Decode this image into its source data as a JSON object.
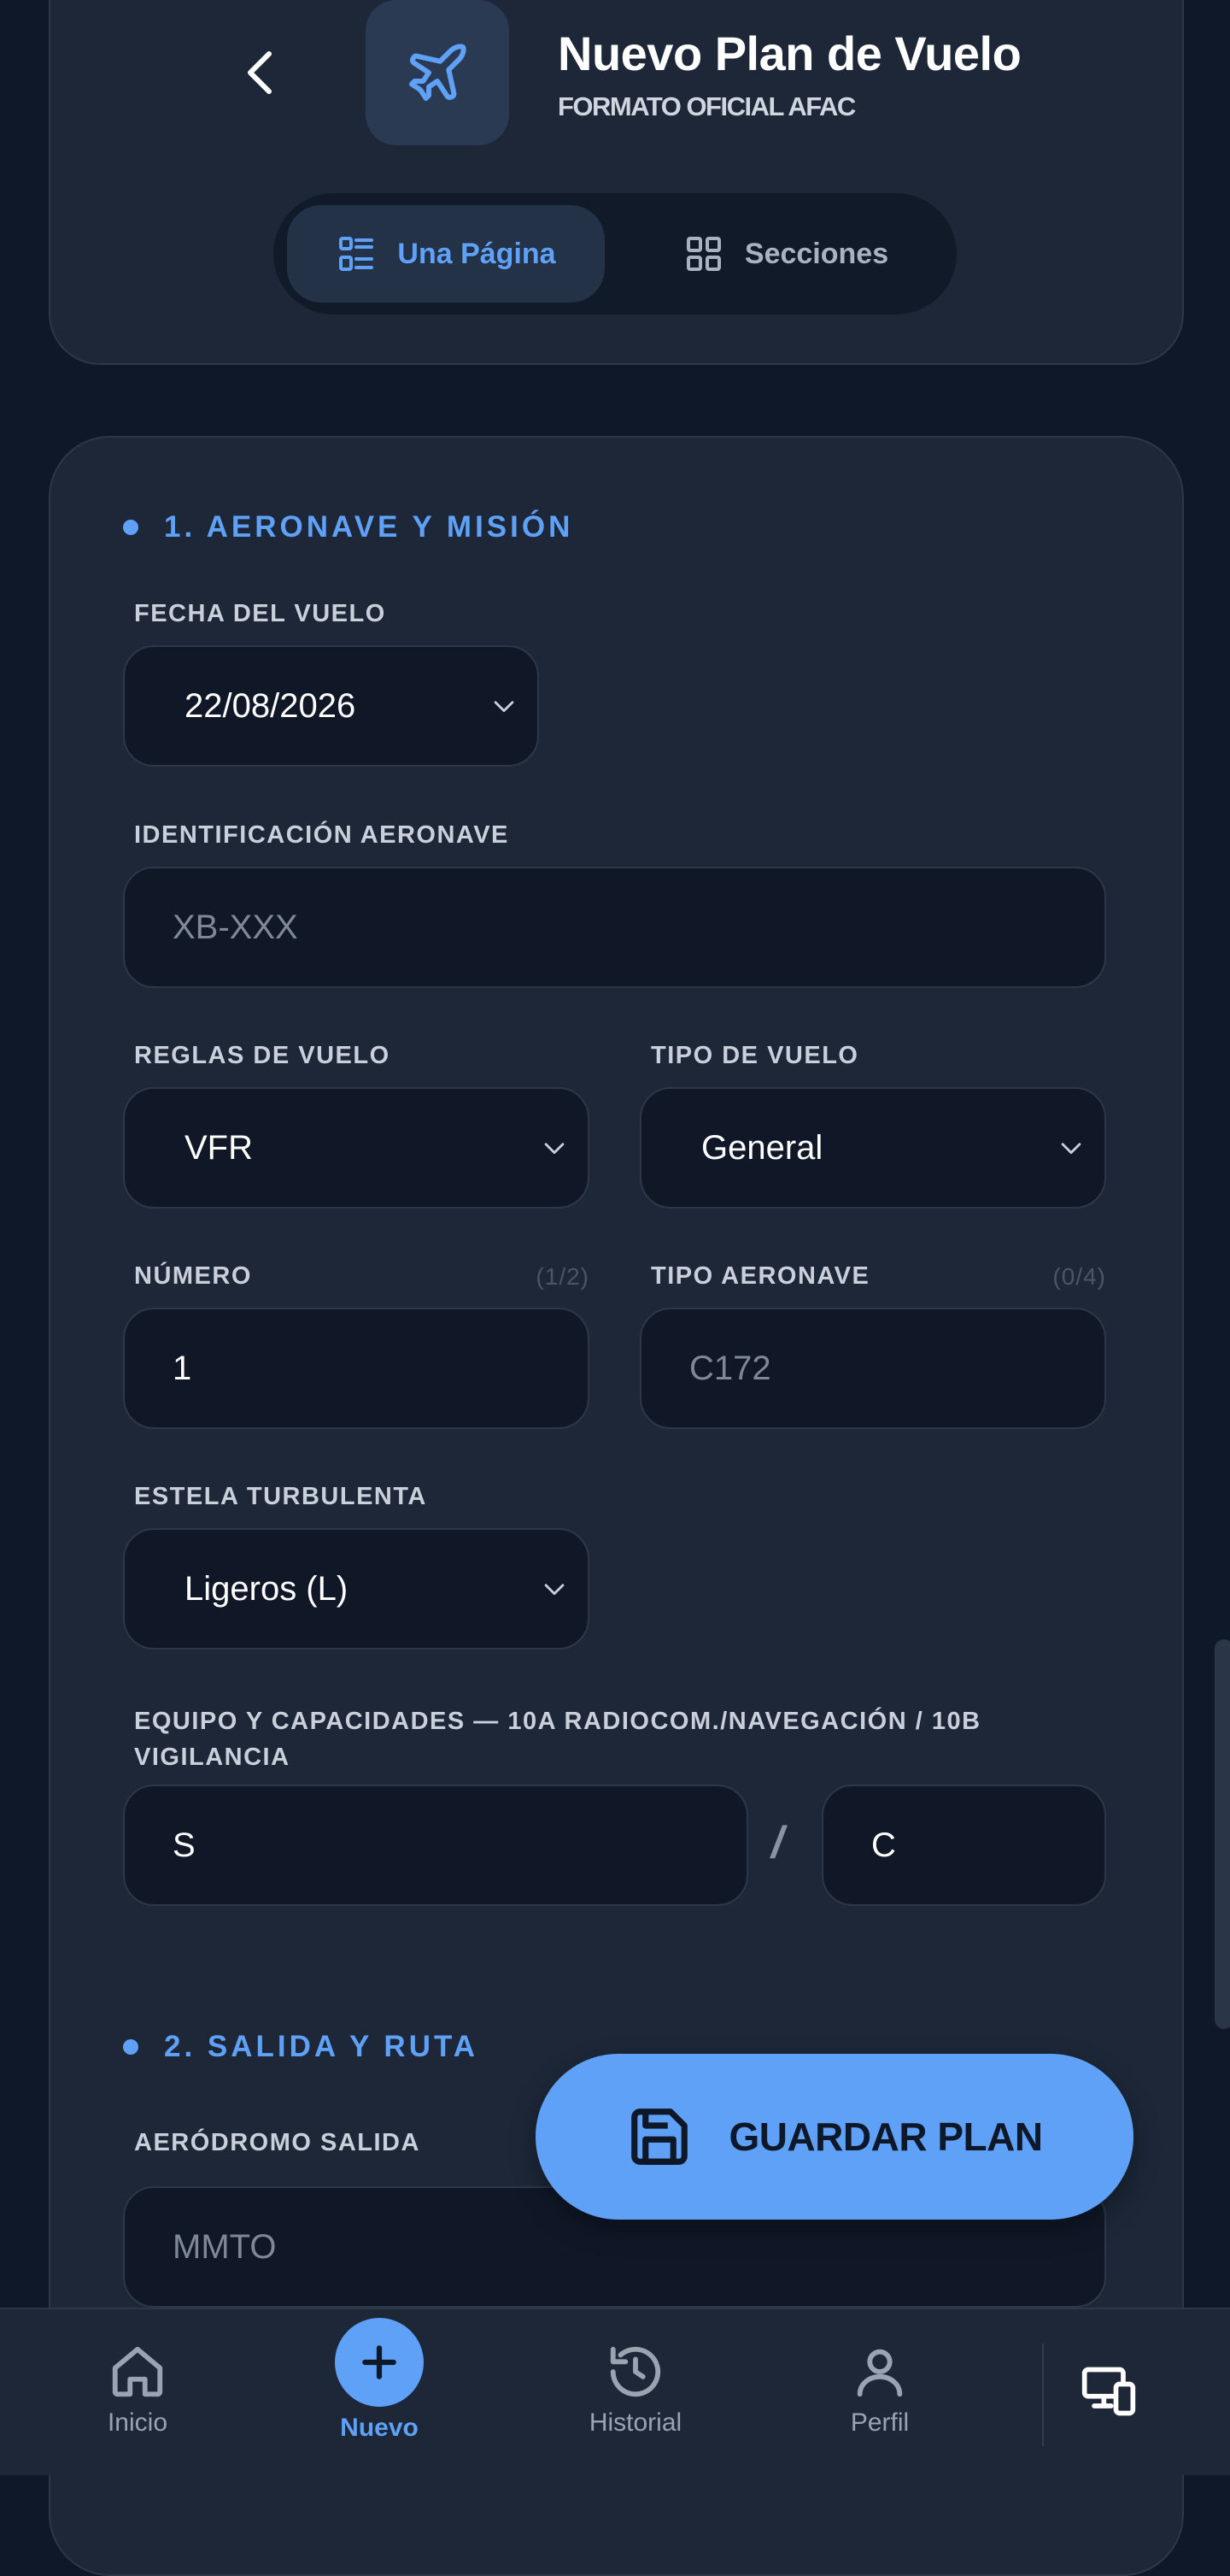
{
  "header": {
    "title": "Nuevo Plan de Vuelo",
    "subtitle": "FORMATO OFICIAL AFAC",
    "back_icon": "chevron-left-icon",
    "app_icon": "airplane-icon"
  },
  "view_toggle": {
    "single_label": "Una Página",
    "sections_label": "Secciones",
    "selected": "Una Página"
  },
  "section1": {
    "title": "1. AERONAVE Y MISIÓN",
    "flight_date": {
      "label": "FECHA DEL VUELO",
      "value": "22/08/2026"
    },
    "aircraft_id": {
      "label": "IDENTIFICACIÓN AERONAVE",
      "placeholder": "XB-XXX",
      "value": ""
    },
    "flight_rules": {
      "label": "REGLAS DE VUELO",
      "value": "VFR"
    },
    "flight_type": {
      "label": "TIPO DE VUELO",
      "value": "General"
    },
    "number": {
      "label": "NÚMERO",
      "counter": "(1/2)",
      "value": "1"
    },
    "aircraft_type": {
      "label": "TIPO AERONAVE",
      "counter": "(0/4)",
      "placeholder": "C172",
      "value": ""
    },
    "wake_turbulence": {
      "label": "ESTELA TURBULENTA",
      "value": "Ligeros (L)"
    },
    "equipment": {
      "label": "EQUIPO Y CAPACIDADES — 10A RADIOCOM./NAVEGACIÓN  /  10B VIGILANCIA",
      "value_10a": "S",
      "separator": "/",
      "value_10b": "C"
    }
  },
  "section2": {
    "title": "2. SALIDA Y RUTA",
    "departure": {
      "label": "AERÓDROMO SALIDA",
      "placeholder": "MMTO",
      "value": ""
    }
  },
  "save_button": {
    "label": "GUARDAR PLAN",
    "icon": "save-icon"
  },
  "bottom_nav": {
    "items": [
      {
        "label": "Inicio",
        "icon": "home-icon"
      },
      {
        "label": "Nuevo",
        "icon": "plus-icon",
        "active": true
      },
      {
        "label": "Historial",
        "icon": "history-icon"
      },
      {
        "label": "Perfil",
        "icon": "user-icon"
      }
    ],
    "extra_icon": "devices-icon"
  },
  "colors": {
    "background": "#0f1828",
    "card": "#1d2738",
    "field": "#101828",
    "accent": "#5ea1f6"
  }
}
